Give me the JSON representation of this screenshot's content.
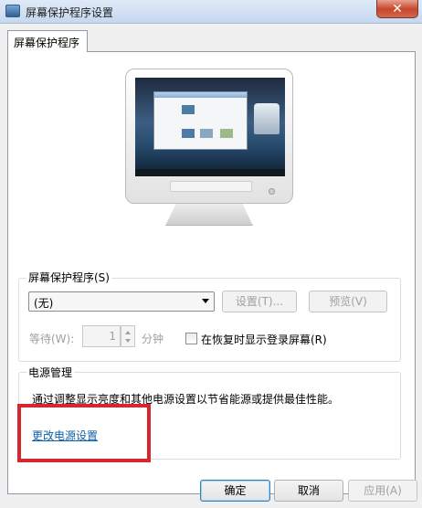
{
  "window": {
    "title": "屏幕保护程序设置",
    "close_glyph": "✕"
  },
  "tab": {
    "label": "屏幕保护程序"
  },
  "screensaver": {
    "group_label": "屏幕保护程序(S)",
    "selected_option": "(无)",
    "settings_button": "设置(T)...",
    "preview_button": "预览(V)",
    "wait_label": "等待(W):",
    "wait_value": "1",
    "minutes_label": "分钟",
    "resume_checkbox_label": "在恢复时显示登录屏幕(R)",
    "resume_checked": false
  },
  "power": {
    "group_label": "电源管理",
    "description": "通过调整显示亮度和其他电源设置以节省能源或提供最佳性能。",
    "link": "更改电源设置"
  },
  "buttons": {
    "ok": "确定",
    "cancel": "取消",
    "apply": "应用(A)"
  },
  "colors": {
    "highlight": "#d8262f",
    "link": "#0f5fa8"
  }
}
